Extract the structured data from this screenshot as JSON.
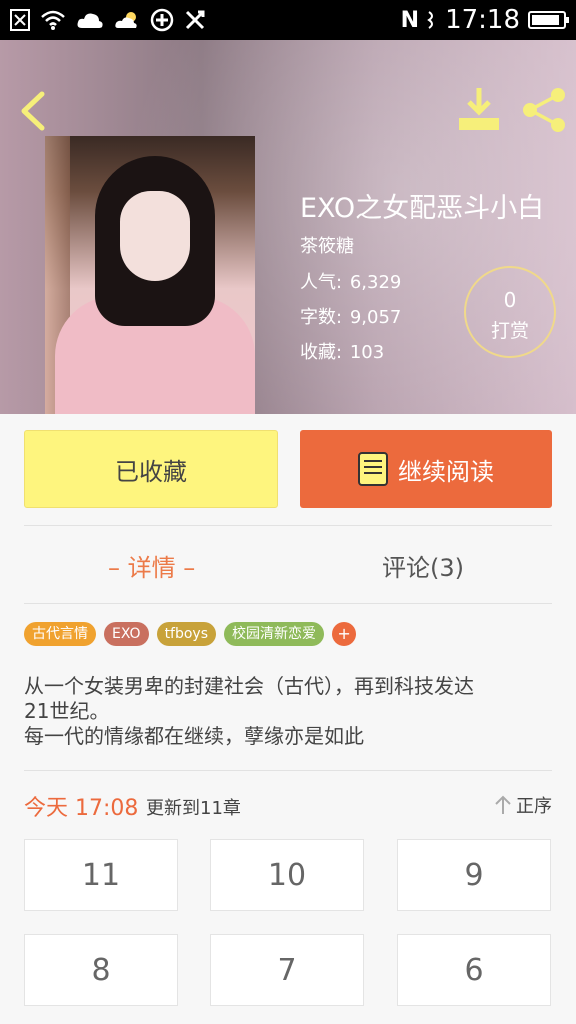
{
  "status_bar": {
    "time": "17:18",
    "network": "N",
    "battery_level": 0.9
  },
  "book": {
    "title": "EXO之女配恶斗小白",
    "author": "茶筱糖",
    "stats": [
      {
        "label": "人气:",
        "value": "6,329"
      },
      {
        "label": "字数:",
        "value": "9,057"
      },
      {
        "label": "收藏:",
        "value": "103"
      }
    ],
    "tip": {
      "count": "0",
      "label": "打赏"
    }
  },
  "actions": {
    "favorite_label": "已收藏",
    "read_label": "继续阅读"
  },
  "tabs": [
    {
      "label": "– 详情 –"
    },
    {
      "label": "评论(3)"
    }
  ],
  "tags": [
    {
      "label": "古代言情",
      "color": "#f0a22f"
    },
    {
      "label": "EXO",
      "color": "#c9705f"
    },
    {
      "label": "tfboys",
      "color": "#c8a23a"
    },
    {
      "label": "校园清新恋爱",
      "color": "#8fba5a"
    },
    {
      "label": "+",
      "color": "#ec6a3d"
    }
  ],
  "description": [
    "从一个女装男卑的封建社会（古代），再到科技发达",
    "21世纪。",
    "每一代的情缘都在继续，孽缘亦是如此"
  ],
  "update": {
    "time": "今天 17:08",
    "text": "更新到11章",
    "sort_label": "正序"
  },
  "chapters": [
    "11",
    "10",
    "9",
    "8",
    "7",
    "6"
  ],
  "colors": {
    "accent_orange": "#ec6a3d",
    "favorite_yellow": "#fef57e",
    "icon_yellow": "#f6ef7a"
  }
}
